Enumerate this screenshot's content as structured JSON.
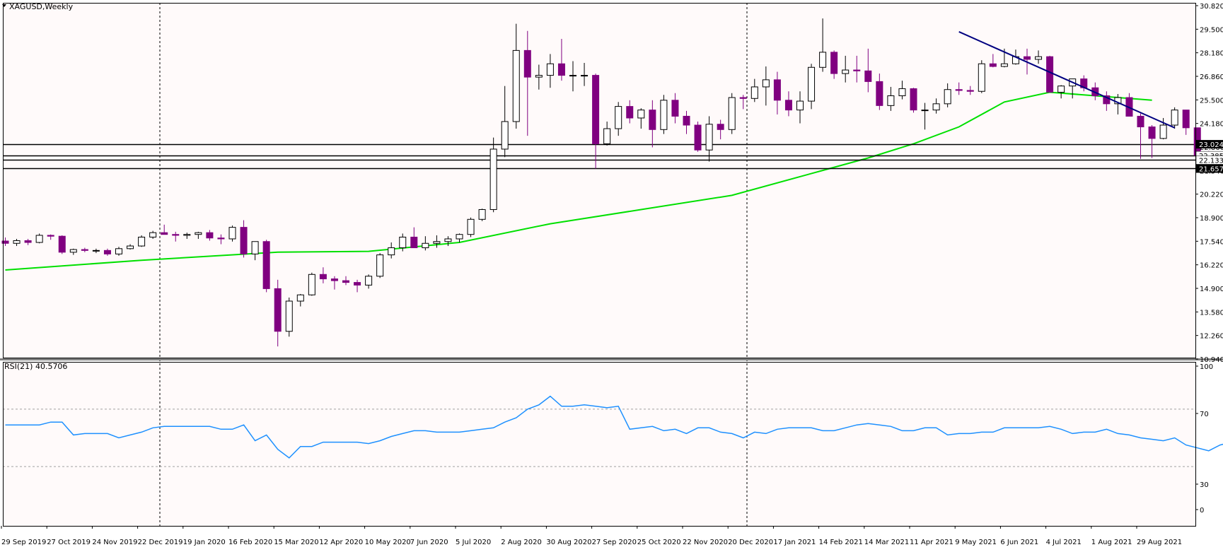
{
  "main_panel": {
    "title": "XAGUSD,Weekly",
    "price_ticks": [
      "30.820",
      "29.500",
      "28.180",
      "26.860",
      "25.500",
      "24.180",
      "22.860",
      "21.540",
      "20.220",
      "18.900",
      "17.540",
      "16.220",
      "14.900",
      "13.580",
      "12.260",
      "10.940"
    ],
    "level_labels": [
      "23.024",
      "22.385",
      "22.133",
      "21.657"
    ]
  },
  "rsi_panel": {
    "title": "RSI(21) 40.5706",
    "ticks": [
      "100",
      "70",
      "30",
      "0"
    ]
  },
  "time_axis": {
    "labels": [
      "29 Sep 2019",
      "27 Oct 2019",
      "24 Nov 2019",
      "22 Dec 2019",
      "19 Jan 2020",
      "16 Feb 2020",
      "15 Mar 2020",
      "12 Apr 2020",
      "10 May 2020",
      "7 Jun 2020",
      "5 Jul 2020",
      "2 Aug 2020",
      "30 Aug 2020",
      "27 Sep 2020",
      "25 Oct 2020",
      "22 Nov 2020",
      "20 Dec 2020",
      "17 Jan 2021",
      "14 Feb 2021",
      "14 Mar 2021",
      "11 Apr 2021",
      "9 May 2021",
      "6 Jun 2021",
      "4 Jul 2021",
      "1 Aug 2021",
      "29 Aug 2021"
    ]
  },
  "colors": {
    "background": "#fffafa",
    "bull": "#ffffff",
    "bear": "#800080",
    "wick": "#000000",
    "ma": "#00e000",
    "trend": "#000080",
    "rsi": "#1e90ff",
    "level": "#000000"
  },
  "chart_data": [
    {
      "type": "candlestick",
      "title": "XAGUSD,Weekly",
      "ylim": [
        10.94,
        30.82
      ],
      "x_start": "2019-09-29",
      "x_step_days": 7,
      "candles": [
        [
          17.58,
          17.78,
          17.3,
          17.45
        ],
        [
          17.45,
          17.7,
          17.3,
          17.6
        ],
        [
          17.6,
          17.7,
          17.35,
          17.5
        ],
        [
          17.5,
          18.0,
          17.45,
          17.9
        ],
        [
          17.9,
          17.95,
          17.65,
          17.85
        ],
        [
          17.85,
          17.9,
          16.85,
          16.95
        ],
        [
          16.95,
          17.15,
          16.8,
          17.1
        ],
        [
          17.1,
          17.2,
          16.95,
          17.05
        ],
        [
          17.05,
          17.15,
          16.9,
          17.05
        ],
        [
          17.05,
          17.15,
          16.75,
          16.85
        ],
        [
          16.85,
          17.25,
          16.75,
          17.15
        ],
        [
          17.15,
          17.4,
          17.1,
          17.3
        ],
        [
          17.3,
          17.9,
          17.25,
          17.8
        ],
        [
          17.8,
          18.15,
          17.7,
          18.05
        ],
        [
          18.05,
          18.5,
          17.95,
          17.95
        ],
        [
          17.95,
          18.1,
          17.55,
          17.9
        ],
        [
          17.9,
          18.05,
          17.7,
          17.95
        ],
        [
          17.95,
          18.1,
          17.7,
          18.05
        ],
        [
          18.05,
          18.2,
          17.6,
          17.75
        ],
        [
          17.75,
          17.95,
          17.4,
          17.7
        ],
        [
          17.7,
          18.45,
          17.55,
          18.35
        ],
        [
          18.35,
          18.75,
          16.65,
          16.85
        ],
        [
          16.85,
          17.5,
          16.5,
          17.55
        ],
        [
          17.55,
          17.65,
          14.7,
          14.9
        ],
        [
          14.9,
          15.4,
          11.65,
          12.5
        ],
        [
          12.5,
          14.4,
          12.2,
          14.2
        ],
        [
          14.2,
          14.6,
          13.9,
          14.55
        ],
        [
          14.55,
          15.8,
          14.5,
          15.7
        ],
        [
          15.7,
          16.1,
          15.2,
          15.45
        ],
        [
          15.45,
          15.6,
          14.85,
          15.35
        ],
        [
          15.35,
          15.6,
          15.1,
          15.25
        ],
        [
          15.25,
          15.4,
          14.7,
          15.1
        ],
        [
          15.1,
          15.7,
          14.9,
          15.6
        ],
        [
          15.6,
          16.9,
          15.5,
          16.8
        ],
        [
          16.8,
          17.5,
          16.6,
          17.2
        ],
        [
          17.2,
          18.0,
          17.0,
          17.8
        ],
        [
          17.8,
          18.35,
          17.2,
          17.2
        ],
        [
          17.2,
          17.85,
          17.05,
          17.45
        ],
        [
          17.45,
          17.9,
          17.2,
          17.55
        ],
        [
          17.55,
          17.85,
          17.3,
          17.7
        ],
        [
          17.7,
          18.0,
          17.5,
          17.95
        ],
        [
          17.95,
          18.9,
          17.8,
          18.8
        ],
        [
          18.8,
          19.4,
          18.7,
          19.35
        ],
        [
          19.35,
          23.4,
          19.2,
          22.75
        ],
        [
          22.75,
          26.3,
          22.3,
          24.3
        ],
        [
          24.3,
          29.8,
          23.9,
          28.3
        ],
        [
          28.3,
          29.4,
          23.5,
          26.8
        ],
        [
          26.8,
          27.5,
          26.1,
          26.9
        ],
        [
          26.9,
          28.1,
          26.2,
          27.55
        ],
        [
          27.55,
          28.95,
          26.6,
          26.9
        ],
        [
          26.9,
          27.7,
          26.0,
          26.9
        ],
        [
          26.9,
          27.6,
          26.3,
          26.9
        ],
        [
          26.9,
          27.0,
          21.65,
          23.05
        ],
        [
          23.05,
          24.3,
          22.95,
          23.9
        ],
        [
          23.9,
          25.4,
          23.5,
          25.15
        ],
        [
          25.15,
          25.5,
          24.2,
          24.5
        ],
        [
          24.5,
          25.05,
          23.9,
          24.95
        ],
        [
          24.95,
          25.5,
          22.85,
          23.85
        ],
        [
          23.85,
          25.8,
          23.6,
          25.5
        ],
        [
          25.5,
          25.9,
          24.2,
          24.6
        ],
        [
          24.6,
          24.9,
          23.6,
          24.1
        ],
        [
          24.1,
          24.3,
          22.6,
          22.7
        ],
        [
          22.7,
          24.6,
          22.05,
          24.15
        ],
        [
          24.15,
          24.4,
          23.3,
          23.85
        ],
        [
          23.85,
          25.9,
          23.6,
          25.65
        ],
        [
          25.65,
          25.8,
          25.0,
          25.6
        ],
        [
          25.6,
          26.7,
          25.4,
          26.25
        ],
        [
          26.25,
          27.4,
          25.2,
          26.65
        ],
        [
          26.65,
          27.1,
          24.7,
          25.5
        ],
        [
          25.5,
          26.0,
          24.6,
          24.95
        ],
        [
          24.95,
          26.0,
          24.2,
          25.45
        ],
        [
          25.45,
          27.55,
          25.0,
          27.35
        ],
        [
          27.35,
          30.1,
          27.1,
          28.2
        ],
        [
          28.2,
          28.3,
          26.7,
          27.0
        ],
        [
          27.0,
          28.0,
          26.5,
          27.2
        ],
        [
          27.2,
          28.0,
          26.5,
          27.15
        ],
        [
          27.15,
          28.4,
          25.95,
          26.55
        ],
        [
          26.55,
          27.0,
          24.95,
          25.2
        ],
        [
          25.2,
          26.25,
          24.9,
          25.75
        ],
        [
          25.75,
          26.6,
          25.55,
          26.15
        ],
        [
          26.15,
          26.2,
          24.8,
          24.95
        ],
        [
          24.95,
          25.35,
          23.85,
          24.95
        ],
        [
          24.95,
          25.6,
          24.75,
          25.3
        ],
        [
          25.3,
          26.45,
          25.1,
          26.1
        ],
        [
          26.1,
          26.5,
          25.8,
          26.05
        ],
        [
          26.05,
          26.3,
          25.8,
          26.0
        ],
        [
          26.0,
          27.75,
          25.9,
          27.55
        ],
        [
          27.55,
          28.1,
          27.35,
          27.4
        ],
        [
          27.4,
          28.4,
          27.35,
          27.55
        ],
        [
          27.55,
          28.35,
          27.5,
          27.95
        ],
        [
          27.95,
          28.4,
          26.95,
          27.8
        ],
        [
          27.8,
          28.3,
          27.55,
          27.95
        ],
        [
          27.95,
          28.0,
          26.0,
          25.95
        ],
        [
          25.95,
          26.35,
          25.6,
          26.3
        ],
        [
          26.3,
          26.5,
          25.6,
          26.7
        ],
        [
          26.7,
          26.9,
          26.0,
          26.2
        ],
        [
          26.2,
          26.5,
          25.5,
          25.75
        ],
        [
          25.75,
          26.0,
          24.9,
          25.3
        ],
        [
          25.3,
          25.85,
          24.7,
          25.65
        ],
        [
          25.65,
          25.9,
          24.6,
          24.6
        ],
        [
          24.6,
          24.75,
          22.2,
          24.0
        ],
        [
          24.0,
          24.1,
          22.25,
          23.35
        ],
        [
          23.35,
          24.5,
          23.3,
          24.1
        ],
        [
          24.1,
          25.1,
          23.9,
          24.95
        ],
        [
          24.95,
          24.95,
          23.55,
          23.95
        ],
        [
          23.95,
          23.95,
          22.1,
          22.4
        ],
        [
          22.4,
          22.65,
          21.9,
          22.15
        ]
      ],
      "levels": [
        23.024,
        22.385,
        22.133,
        21.657
      ],
      "ma_series": [
        [
          "2019-09-29",
          15.95
        ],
        [
          "2019-12-22",
          16.5
        ],
        [
          "2020-03-15",
          16.95
        ],
        [
          "2020-05-10",
          17.0
        ],
        [
          "2020-07-05",
          17.5
        ],
        [
          "2020-08-30",
          18.55
        ],
        [
          "2020-10-25",
          19.35
        ],
        [
          "2020-12-20",
          20.15
        ],
        [
          "2021-02-14",
          21.55
        ],
        [
          "2021-03-14",
          22.25
        ],
        [
          "2021-04-11",
          23.05
        ],
        [
          "2021-05-09",
          24.0
        ],
        [
          "2021-06-06",
          25.4
        ],
        [
          "2021-07-04",
          25.95
        ],
        [
          "2021-08-01",
          25.75
        ],
        [
          "2021-09-05",
          25.5
        ]
      ],
      "trendline": [
        [
          "2021-05-09",
          29.35
        ],
        [
          "2021-09-19",
          23.95
        ]
      ]
    },
    {
      "type": "line",
      "title": "RSI(21) 40.5706",
      "ylim": [
        0,
        100
      ],
      "ticks": [
        100,
        70,
        30,
        0
      ],
      "series": [
        {
          "values": [
            59,
            59,
            59,
            59,
            61,
            61,
            52,
            53,
            53,
            53,
            50,
            52,
            54,
            57,
            58,
            58,
            58,
            58,
            58,
            56,
            56,
            59,
            48,
            52,
            42,
            36,
            44,
            44,
            47,
            47,
            47,
            47,
            46,
            48,
            51,
            53,
            55,
            55,
            54,
            54,
            54,
            55,
            56,
            57,
            61,
            64,
            70,
            73,
            79,
            72,
            72,
            73,
            72,
            71,
            72,
            56,
            57,
            58,
            55,
            56,
            53,
            57,
            57,
            54,
            53,
            50,
            54,
            53,
            56,
            57,
            57,
            57,
            55,
            55,
            57,
            59,
            60,
            59,
            58,
            55,
            55,
            57,
            57,
            52,
            53,
            53,
            54,
            54,
            57,
            57,
            57,
            57,
            58,
            56,
            53,
            54,
            54,
            56,
            53,
            52,
            50,
            49,
            48,
            50,
            45,
            43,
            41,
            45,
            47,
            46,
            43,
            42,
            41
          ]
        }
      ]
    }
  ]
}
